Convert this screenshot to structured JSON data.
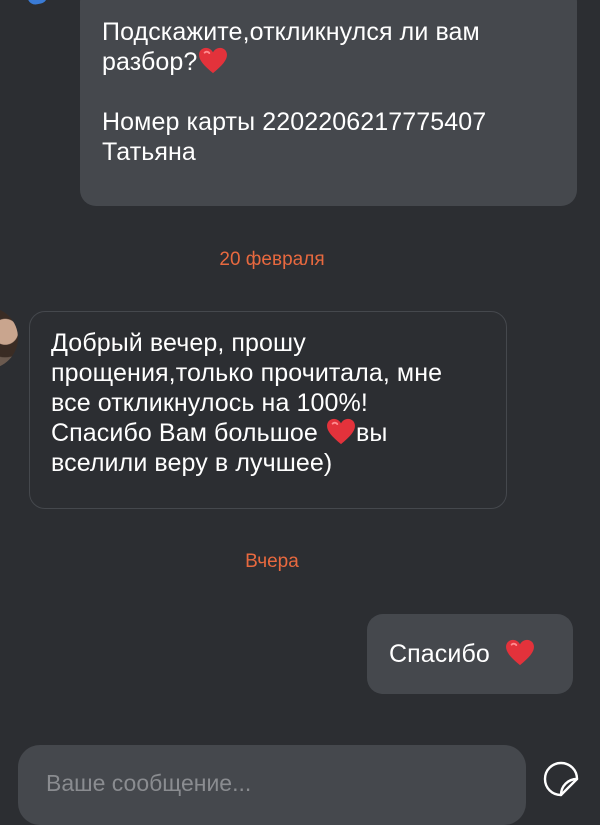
{
  "messages": {
    "top_outgoing": {
      "line1": "Подскажите,откликнулся ли вам",
      "line2": "разбор?",
      "line3": "Номер карты 2202206217775407",
      "line4": "Татьяна"
    },
    "date_feb": "20 февраля",
    "incoming": {
      "line1": "Добрый вечер, прошу",
      "line2": "прощения,только прочитала, мне",
      "line3": "все откликнулось на 100%!",
      "line4a": "Спасибо Вам большое",
      "line4b": "вы",
      "line5": "вселили веру в лучшее)"
    },
    "date_yesterday": "Вчера",
    "thanks_outgoing": {
      "text": "Спасибо"
    }
  },
  "composer": {
    "placeholder": "Ваше сообщение..."
  },
  "icons": {
    "heart": "heart-emoji-icon",
    "sticker": "sticker-icon"
  },
  "colors": {
    "background": "#2c2e32",
    "bubble": "#45484d",
    "date_accent": "#e8693f",
    "heart": "#e3323b"
  }
}
